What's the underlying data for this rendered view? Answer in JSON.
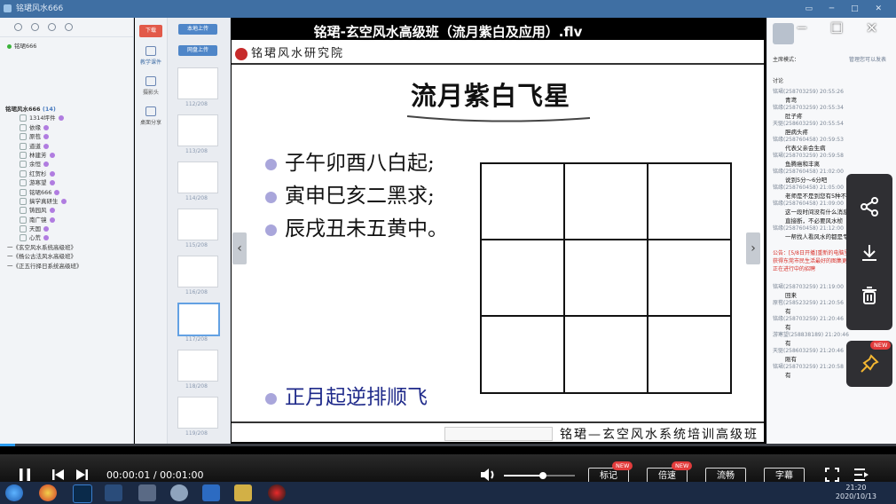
{
  "app": {
    "title": "铭珺风水666",
    "user": "铭珺666"
  },
  "tree": {
    "root": "铭珺风水666",
    "root_count": "(14)",
    "members": [
      "1314坪件",
      "依缘",
      "原苞",
      "道道",
      "林建芳",
      "余恒",
      "红贺杉",
      "游寒望",
      "铭珺666",
      "搞学真研生",
      "铸园风",
      "南广镜",
      "天国",
      "心荒"
    ],
    "groups": [
      "一《玄空风水系统高级班》",
      "一《杨公古法风水高级班》",
      "一《正五行择日系统高级班》"
    ]
  },
  "tools": {
    "red_tab": "下载",
    "items": [
      "教学课件",
      "摄影头",
      "桌面分享"
    ]
  },
  "thumbs": {
    "upload_button": "本地上传",
    "net_button": "网盘上传",
    "pages": [
      "112/208",
      "113/208",
      "114/208",
      "115/208",
      "116/208",
      "117/208",
      "118/208",
      "119/208"
    ]
  },
  "slide": {
    "header": "铭珺风水研究院",
    "title": "流月紫白飞星",
    "bullets": [
      "子午卯酉八白起;",
      "寅申巳亥二黑求;",
      "辰戌丑未五黄中。"
    ],
    "highlight": "正月起逆排顺飞",
    "footer": "铭珺—玄空风水系统培训高级班",
    "grid": {
      "rows": 3,
      "cols": 3
    }
  },
  "chat": {
    "mode_label": "主席模式：",
    "tabs_label": "管理您可以发表",
    "section": "讨论",
    "messages": [
      {
        "meta": "铭珺(258703259) 20:55:26",
        "text": "青鸢"
      },
      {
        "meta": "铭缘(258703259) 20:55:34",
        "text": "肚子疼"
      },
      {
        "meta": "天驱(258603259) 20:55:54",
        "text": "胆病头疼"
      },
      {
        "meta": "铭缘(258760458) 20:59:53",
        "text": "代表父亲会生病"
      },
      {
        "meta": "铭珺(258703259) 20:59:58",
        "text": "鱼腾癌和丰离"
      },
      {
        "meta": "铭缘(258760458) 21:02:00",
        "text": "说到5分～6分吧"
      },
      {
        "meta": "铭缘(258760458) 21:05:00",
        "text": "老师是不是到您有5种不到"
      },
      {
        "meta": "铭缘(258760458) 21:09:00",
        "text": "这一段时间没有什么消息，直不顺可以直接断，不必要风水桢"
      },
      {
        "meta": "铭缘(258760458) 21:12:00",
        "text": "一帮找人看风水的都是专业的去找"
      }
    ],
    "notice": "公告：[5/8日开播]重新的电脑里应该7小时即可获得东莞市民生活最好的图集更多及实际请选择正在进行中的招聘",
    "messages2": [
      {
        "meta": "铭珺(258703259) 21:19:00",
        "text": "回来"
      },
      {
        "meta": "原苞(258523259) 21:20:56",
        "text": "有"
      },
      {
        "meta": "铭缘(258703259) 21:20:46",
        "text": "有"
      },
      {
        "meta": "游寒望(258838189) 21:20:46",
        "text": "有"
      },
      {
        "meta": "天驱(258603259) 21:20:46",
        "text": "刚有"
      },
      {
        "meta": "铭珺(258703259) 21:20:58",
        "text": "有"
      }
    ]
  },
  "player": {
    "video_title": "铭珺-玄空风水高级班（流月紫白及应用）.flv",
    "time": "00:00:01 / 00:01:00",
    "progress": 0.017,
    "volume": 0.55,
    "buttons": [
      {
        "label": "标记",
        "new": "NEW"
      },
      {
        "label": "倍速",
        "new": "NEW"
      },
      {
        "label": "流畅",
        "new": ""
      },
      {
        "label": "字幕",
        "new": ""
      }
    ],
    "side_new": "NEW"
  },
  "taskbar": {
    "clock": "21:20",
    "date": "2020/10/13"
  }
}
